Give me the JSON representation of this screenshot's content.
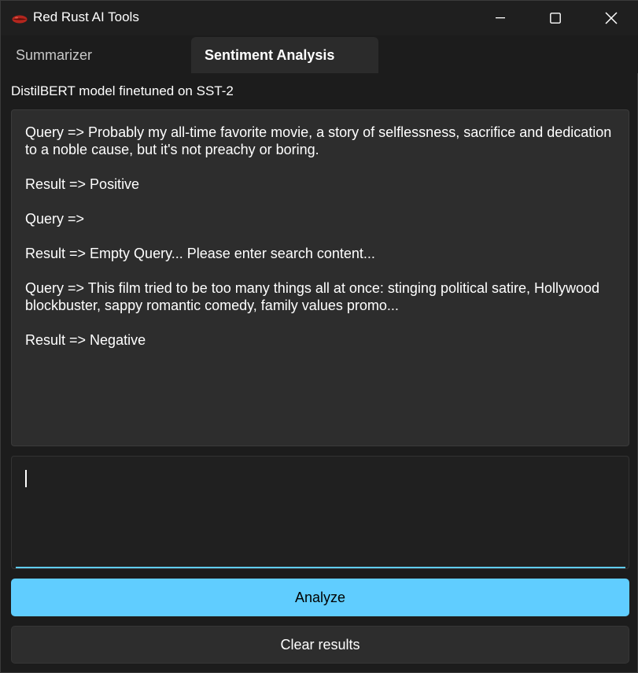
{
  "window": {
    "title": "Red Rust AI Tools",
    "icons": {
      "app": "lips-icon",
      "minimize": "minimize-icon",
      "maximize": "maximize-icon",
      "close": "close-icon"
    }
  },
  "tabs": [
    {
      "label": "Summarizer",
      "active": false
    },
    {
      "label": "Sentiment Analysis",
      "active": true
    }
  ],
  "sentiment": {
    "model_label": "DistilBERT model finetuned on SST-2",
    "results_text": "Query => Probably my all-time favorite movie, a story of selflessness, sacrifice and dedication to a noble cause, but it's not preachy or boring.\n\nResult => Positive\n\nQuery =>\n\nResult => Empty Query... Please enter search content...\n\nQuery => This film tried to be too many things all at once: stinging political satire, Hollywood blockbuster, sappy romantic comedy, family values promo...\n\nResult => Negative",
    "input_value": "",
    "analyze_label": "Analyze",
    "clear_label": "Clear results"
  },
  "colors": {
    "accent": "#60cdff",
    "background": "#1c1c1c",
    "panel": "#2d2d2d",
    "logo_red": "#c42b1c"
  }
}
